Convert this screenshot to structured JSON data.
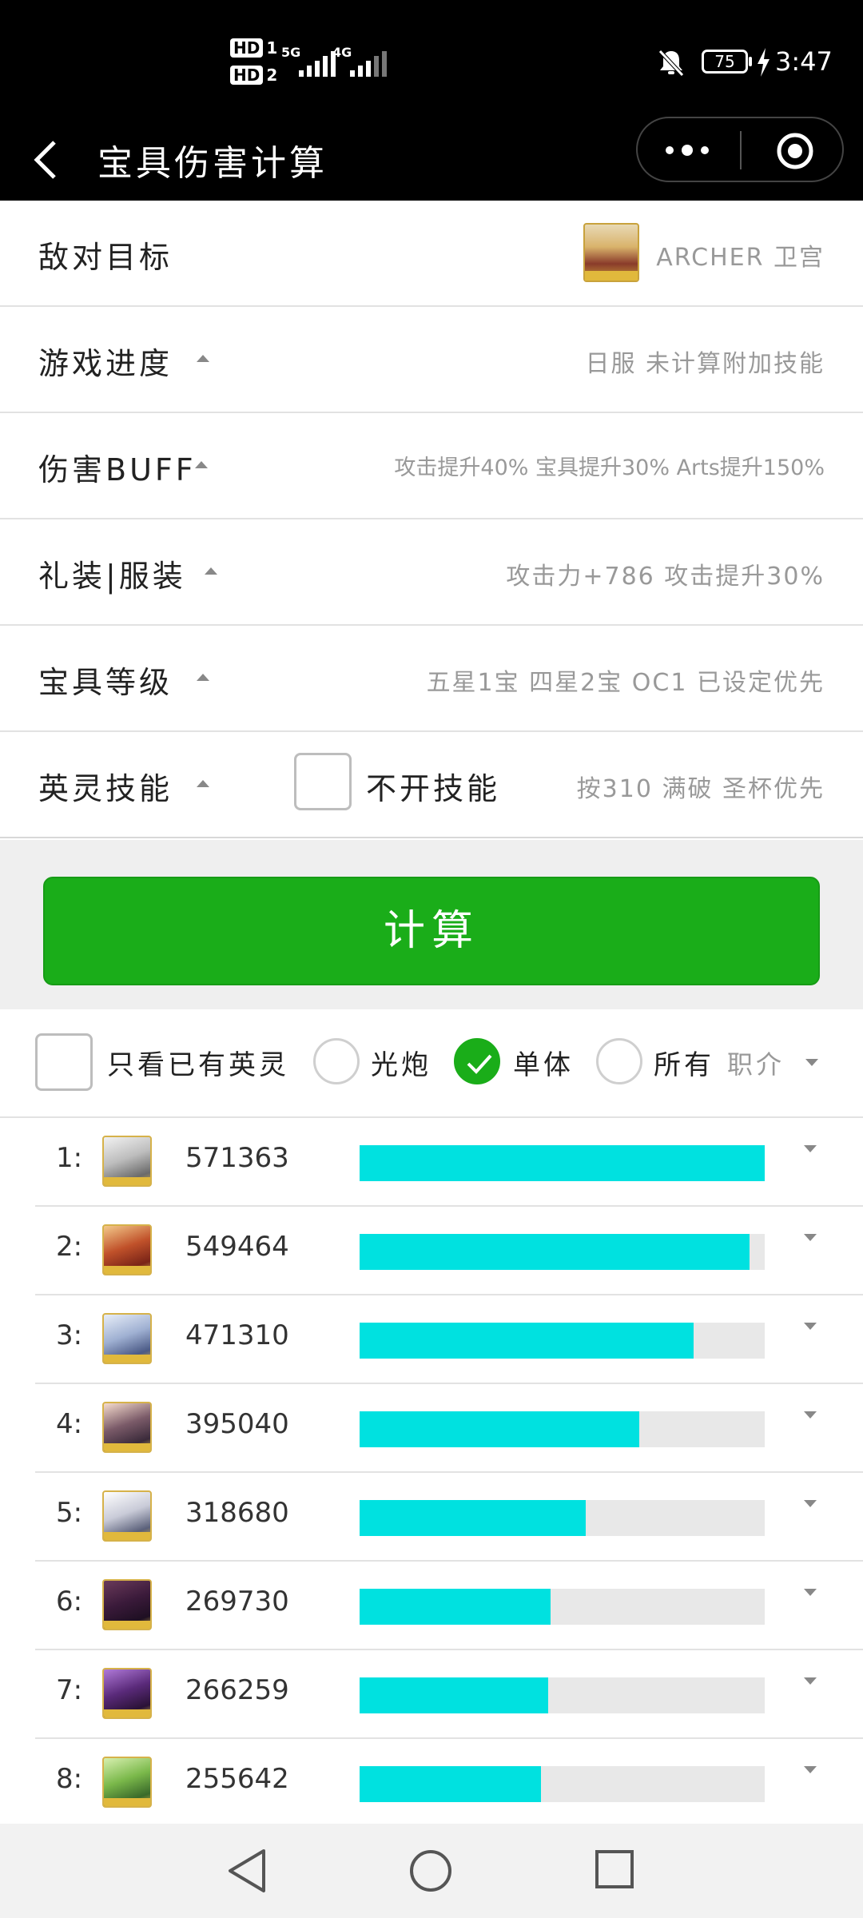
{
  "status_bar": {
    "sim1_label": "HD",
    "sim1_num": "1",
    "sim2_label": "HD",
    "sim2_num": "2",
    "net1": "5G",
    "net2": "4G",
    "battery": "75",
    "time": "3:47"
  },
  "nav": {
    "title": "宝具伤害计算",
    "back_icon": "chevron-left-icon",
    "more_icon": "more-dots-icon",
    "close_icon": "target-circle-icon"
  },
  "settings": {
    "enemy": {
      "label": "敌对目标",
      "value": "ARCHER 卫宫"
    },
    "progress": {
      "label": "游戏进度",
      "value": "日服 未计算附加技能"
    },
    "buff": {
      "label": "伤害BUFF",
      "value": "攻击提升40% 宝具提升30% Arts提升150%"
    },
    "ce": {
      "label": "礼装|服装",
      "value": "攻击力+786 攻击提升30%"
    },
    "np_level": {
      "label": "宝具等级",
      "value": "五星1宝 四星2宝 OC1 已设定优先"
    },
    "skill": {
      "label": "英灵技能",
      "checkbox_label": "不开技能",
      "value": "按310 满破 圣杯优先"
    }
  },
  "calc_button": "计算",
  "filters": {
    "owned_only": "只看已有英灵",
    "aoe": "光炮",
    "single": "单体",
    "all": "所有",
    "class": "职介",
    "selected": "single"
  },
  "ranking": [
    {
      "rank": "1:",
      "damage": "571363",
      "ratio": 1.0
    },
    {
      "rank": "2:",
      "damage": "549464",
      "ratio": 0.962
    },
    {
      "rank": "3:",
      "damage": "471310",
      "ratio": 0.825
    },
    {
      "rank": "4:",
      "damage": "395040",
      "ratio": 0.691
    },
    {
      "rank": "5:",
      "damage": "318680",
      "ratio": 0.558
    },
    {
      "rank": "6:",
      "damage": "269730",
      "ratio": 0.472
    },
    {
      "rank": "7:",
      "damage": "266259",
      "ratio": 0.466
    },
    {
      "rank": "8:",
      "damage": "255642",
      "ratio": 0.447
    }
  ],
  "colors": {
    "bar_fill": "#00e1e0",
    "bar_track": "#e8e8e8",
    "primary_green": "#1aad19"
  }
}
